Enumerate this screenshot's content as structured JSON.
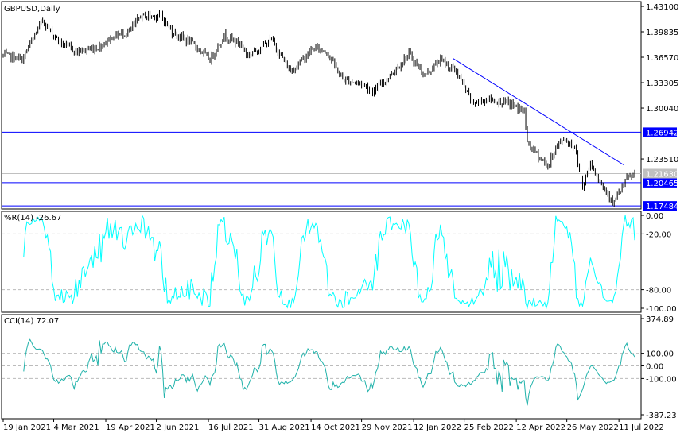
{
  "chart_data": {
    "type": "bar",
    "title": "GBPUSD,Daily",
    "symbol": "GBPUSD",
    "timeframe": "Daily",
    "price_axis": {
      "ticks": [
        "1.43100",
        "1.39835",
        "1.36570",
        "1.33305",
        "1.30040",
        "1.23510"
      ],
      "ylim": [
        1.1685,
        1.437
      ]
    },
    "price_keypoints": [
      [
        2,
        1.3678
      ],
      [
        12,
        1.3627
      ],
      [
        25,
        1.4137
      ],
      [
        30,
        1.3984
      ],
      [
        37,
        1.3831
      ],
      [
        47,
        1.3729
      ],
      [
        60,
        1.378
      ],
      [
        70,
        1.3933
      ],
      [
        80,
        1.3984
      ],
      [
        87,
        1.4188
      ],
      [
        100,
        1.4188
      ],
      [
        107,
        1.3984
      ],
      [
        120,
        1.3831
      ],
      [
        131,
        1.3627
      ],
      [
        140,
        1.3933
      ],
      [
        150,
        1.3831
      ],
      [
        155,
        1.3678
      ],
      [
        170,
        1.3882
      ],
      [
        182,
        1.3474
      ],
      [
        197,
        1.378
      ],
      [
        205,
        1.3729
      ],
      [
        215,
        1.3372
      ],
      [
        227,
        1.3321
      ],
      [
        235,
        1.3219
      ],
      [
        245,
        1.3423
      ],
      [
        257,
        1.3698
      ],
      [
        267,
        1.3423
      ],
      [
        277,
        1.3627
      ],
      [
        287,
        1.3474
      ],
      [
        297,
        1.3066
      ],
      [
        307,
        1.3117
      ],
      [
        320,
        1.3066
      ],
      [
        330,
        1.2964
      ],
      [
        332,
        1.2556
      ],
      [
        345,
        1.225
      ],
      [
        350,
        1.2505
      ],
      [
        355,
        1.2607
      ],
      [
        362,
        1.2505
      ],
      [
        367,
        1.1995
      ],
      [
        372,
        1.2301
      ],
      [
        380,
        1.1995
      ],
      [
        387,
        1.1791
      ],
      [
        395,
        1.2097
      ],
      [
        400,
        1.2163
      ]
    ],
    "horizontal_lines": [
      {
        "price": 1.26942,
        "label": "1.26942",
        "color": "#0000ff"
      },
      {
        "price": 1.20465,
        "label": "1.20465",
        "color": "#0000ff"
      },
      {
        "price": 1.17484,
        "label": "1.17484",
        "color": "#0000ff"
      },
      {
        "price": 1.2163,
        "label": "1.21630",
        "color": "#c0c0c0"
      }
    ],
    "trendline": {
      "from": [
        285,
        1.364
      ],
      "to": [
        393,
        1.2275
      ],
      "color": "#0000ff"
    },
    "indicators": [
      {
        "name": "%R(14)",
        "label": "%R(14) -26.67",
        "color": "#00ffff",
        "ticks": [
          "0.00",
          "-20.00",
          "-80.00",
          "-100.00"
        ],
        "levels": [
          -20,
          -80
        ],
        "ylim": [
          -100,
          0
        ],
        "last": -26.67
      },
      {
        "name": "CCI(14)",
        "label": "CCI(14) 72.07",
        "color": "#20b2aa",
        "ticks": [
          "374.89",
          "100.00",
          "0.00",
          "-100.00",
          "-387.23"
        ],
        "levels": [
          100,
          0,
          -100
        ],
        "ylim": [
          -387.23,
          374.89
        ],
        "last": 72.07
      }
    ],
    "x_labels": [
      "19 Jan 2021",
      "4 Mar 2021",
      "19 Apr 2021",
      "2 Jun 2021",
      "16 Jul 2021",
      "31 Aug 2021",
      "14 Oct 2021",
      "29 Nov 2021",
      "12 Jan 2022",
      "25 Feb 2022",
      "12 Apr 2022",
      "26 May 2022",
      "11 Jul 2022"
    ],
    "x_label_bars": [
      0,
      32,
      65,
      97,
      130,
      162,
      195,
      227,
      260,
      292,
      325,
      357,
      390
    ]
  }
}
